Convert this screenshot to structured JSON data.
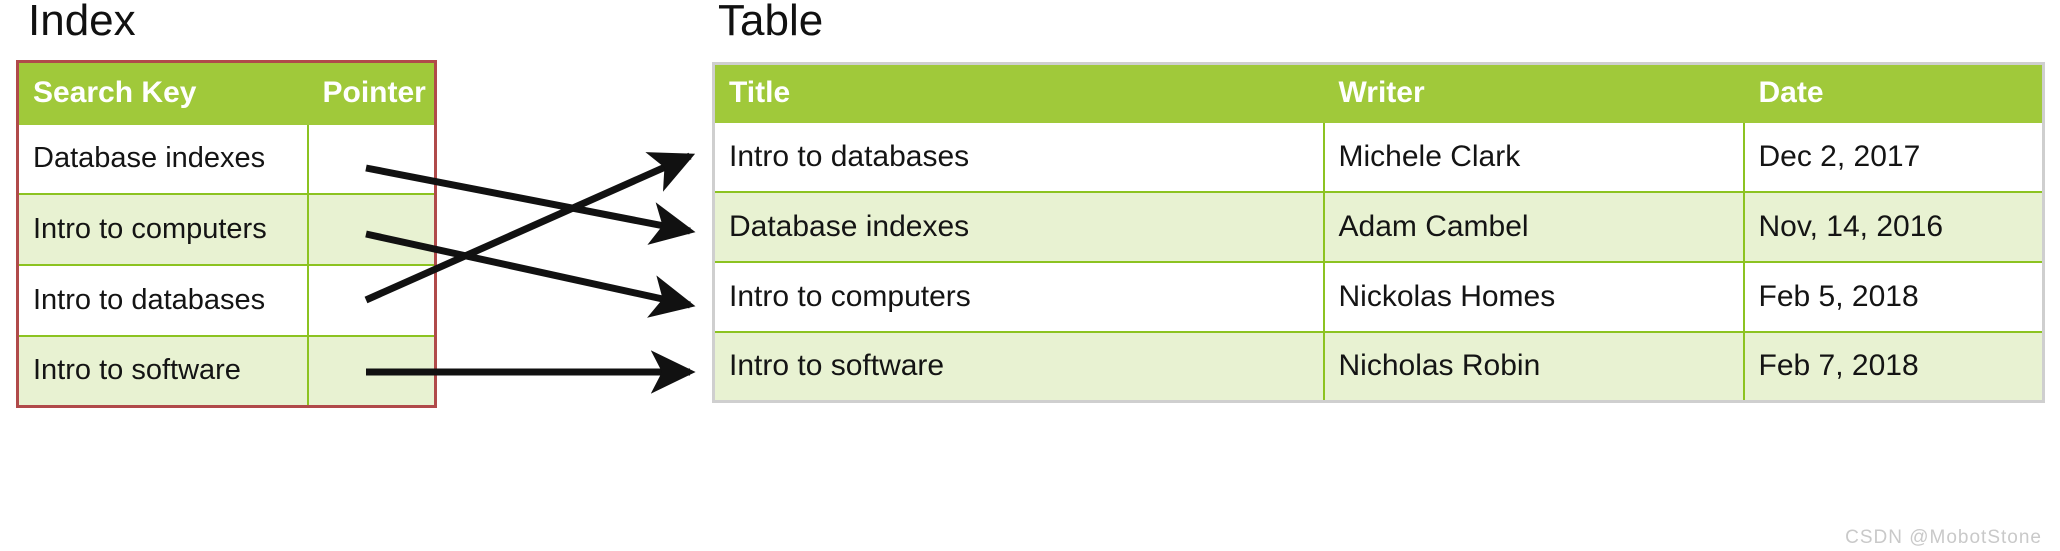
{
  "index": {
    "heading": "Index",
    "columns": [
      "Search Key",
      "Pointer"
    ],
    "rows": [
      {
        "search_key": "Database indexes",
        "pointer": ""
      },
      {
        "search_key": "Intro to computers",
        "pointer": ""
      },
      {
        "search_key": "Intro to databases",
        "pointer": ""
      },
      {
        "search_key": " Intro to software",
        "pointer": ""
      }
    ]
  },
  "table": {
    "heading": "Table",
    "columns": [
      "Title",
      "Writer",
      "Date"
    ],
    "rows": [
      {
        "title": "Intro to databases",
        "writer": "Michele Clark",
        "date": "Dec 2, 2017"
      },
      {
        "title": " Database indexes",
        "writer": "Adam Cambel",
        "date": "Nov, 14, 2016"
      },
      {
        "title": " Intro to computers",
        "writer": "Nickolas Homes",
        "date": "Feb 5, 2018"
      },
      {
        "title": "Intro to software",
        "writer": "Nicholas Robin",
        "date": "Feb 7, 2018"
      }
    ]
  },
  "connectors": [
    {
      "name": "database-indexes-pointer-arrow",
      "from_row": 0,
      "to_row": 1
    },
    {
      "name": "intro-to-computers-pointer-arrow",
      "from_row": 1,
      "to_row": 2
    },
    {
      "name": "intro-to-databases-pointer-arrow",
      "from_row": 2,
      "to_row": 0
    },
    {
      "name": "intro-to-software-pointer-arrow",
      "from_row": 3,
      "to_row": 3
    }
  ],
  "watermark": "CSDN @MobotStone",
  "colors": {
    "header_green": "#a0c93a",
    "row_alt_green": "#e8f2d2",
    "index_border_red": "#b04a4a",
    "table_border_grey": "#cfcfcf",
    "grid_green": "#8cc321",
    "arrow_black": "#111111",
    "text": "#141414",
    "header_text": "#ffffff"
  }
}
